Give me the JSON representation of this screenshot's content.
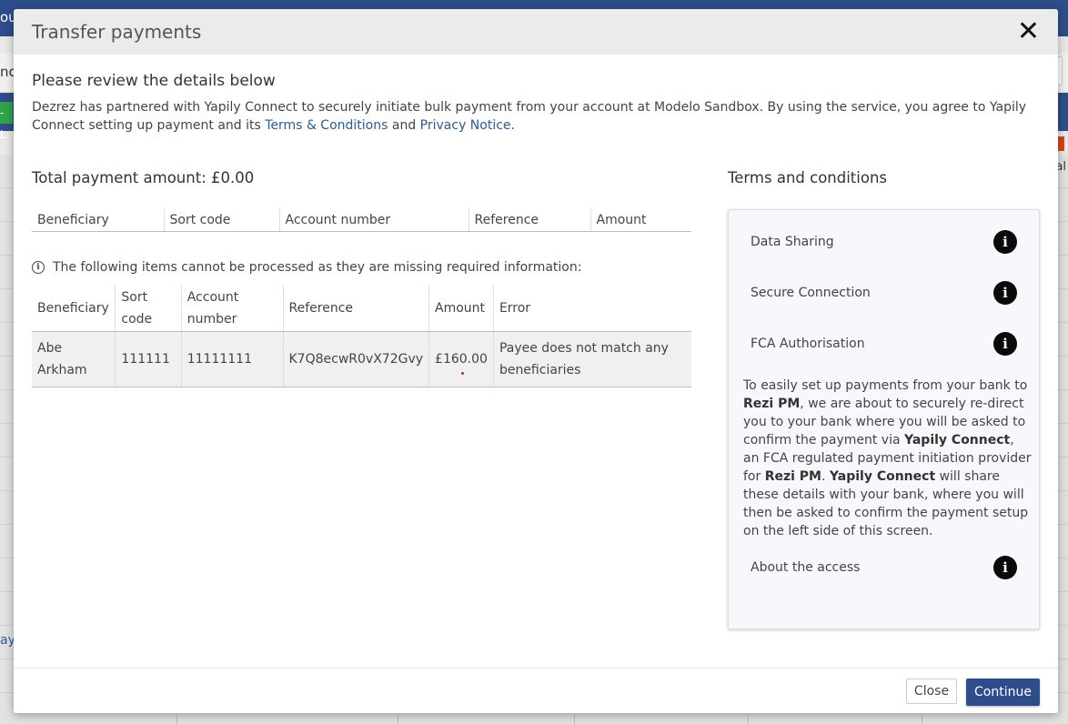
{
  "background": {
    "topbar_text": "ou",
    "toolbar_text": "nc",
    "green_tag": "- L",
    "right_text": "al",
    "link_text": "ay"
  },
  "modal": {
    "title": "Transfer payments",
    "close_symbol": "✕",
    "review_heading": "Please review the details below",
    "intro_part1": "Dezrez has partnered with Yapily Connect to securely initiate bulk payment from your account at Modelo Sandbox. By using the service, you agree to Yapily Connect setting up payment and its ",
    "terms_link": "Terms & Conditions",
    "intro_part2": " and ",
    "privacy_link": "Privacy Notice",
    "intro_part3": ".",
    "total_label": "Total payment amount: £0.00",
    "main_table": {
      "headers": [
        "Beneficiary",
        "Sort code",
        "Account number",
        "Reference",
        "Amount"
      ]
    },
    "warning": "The following items cannot be processed as they are missing required information:",
    "error_table": {
      "headers": [
        "Beneficiary",
        "Sort code",
        "Account number",
        "Reference",
        "Amount",
        "Error"
      ],
      "rows": [
        {
          "beneficiary": "Abe Arkham",
          "sort_code": "111111",
          "account_number": "11111111",
          "reference": "K7Q8ecwR0vX72Gvy",
          "amount": "£160.00",
          "error": "Payee does not match any beneficiaries"
        }
      ]
    },
    "terms": {
      "heading": "Terms and conditions",
      "items": [
        "Data Sharing",
        "Secure Connection",
        "FCA Authorisation",
        "About the access"
      ],
      "body_1": "To easily set up payments from your bank to ",
      "body_b1": "Rezi PM",
      "body_2": ", we are about to securely re-direct you to your bank where you will be asked to confirm the payment via ",
      "body_b2": "Yapily Connect",
      "body_3": ", an FCA regulated payment initiation provider for ",
      "body_b3": "Rezi PM",
      "body_4": ". ",
      "body_b4": "Yapily Connect",
      "body_5": " will share these details with your bank, where you will then be asked to confirm the payment setup on the left side of this screen."
    },
    "footer": {
      "close_label": "Close",
      "continue_label": "Continue"
    }
  }
}
